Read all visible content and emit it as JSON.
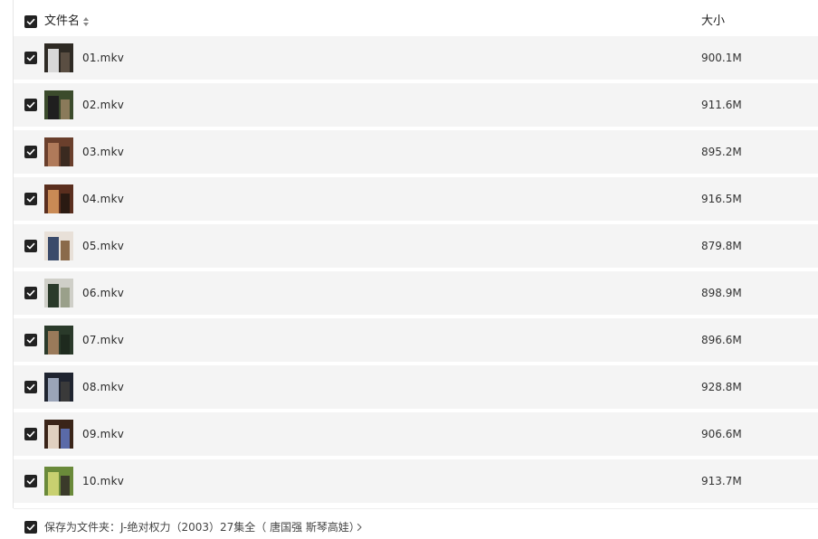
{
  "header": {
    "name_label": "文件名",
    "size_label": "大小"
  },
  "files": [
    {
      "name": "01.mkv",
      "size": "900.1M",
      "thumb": [
        "#2e2a24",
        "#d8d8d8",
        "#5a4e42"
      ]
    },
    {
      "name": "02.mkv",
      "size": "911.6M",
      "thumb": [
        "#3b4b2c",
        "#1f1f1f",
        "#8a7a5a"
      ]
    },
    {
      "name": "03.mkv",
      "size": "895.2M",
      "thumb": [
        "#6a3f2c",
        "#b07a5a",
        "#3a2a20"
      ]
    },
    {
      "name": "04.mkv",
      "size": "916.5M",
      "thumb": [
        "#5a2e1e",
        "#c98a55",
        "#2a1a12"
      ]
    },
    {
      "name": "05.mkv",
      "size": "879.8M",
      "thumb": [
        "#e8e0d8",
        "#3a4a6a",
        "#8a6a4a"
      ]
    },
    {
      "name": "06.mkv",
      "size": "898.9M",
      "thumb": [
        "#cfcfc8",
        "#2a3a2a",
        "#9aa08a"
      ]
    },
    {
      "name": "07.mkv",
      "size": "896.6M",
      "thumb": [
        "#2a3a2a",
        "#9a7a5a",
        "#1e2a1e"
      ]
    },
    {
      "name": "08.mkv",
      "size": "928.8M",
      "thumb": [
        "#1f2430",
        "#9aa4b8",
        "#3a3a3a"
      ]
    },
    {
      "name": "09.mkv",
      "size": "906.6M",
      "thumb": [
        "#3a2418",
        "#e0d0c0",
        "#5a6aa8"
      ]
    },
    {
      "name": "10.mkv",
      "size": "913.7M",
      "thumb": [
        "#6a8a3a",
        "#c8d070",
        "#3a3a2a"
      ]
    }
  ],
  "footer": {
    "save_label": "保存为文件夹：J-绝对权力（2003）27集全（ 唐国强 斯琴高娃）"
  }
}
